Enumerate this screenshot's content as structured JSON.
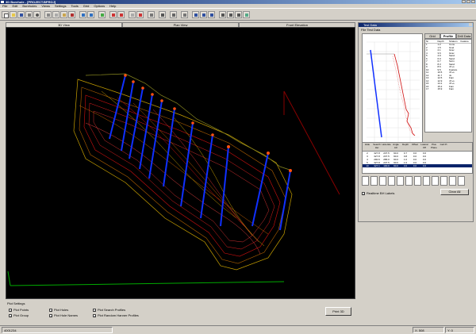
{
  "window": {
    "title": "3D Borehole - [PROJECT.BPROJ]"
  },
  "menu": [
    "File",
    "Edit",
    "Boreholes",
    "Views",
    "Settings",
    "Tools",
    "Grid",
    "Options",
    "Help"
  ],
  "tabs": [
    {
      "label": "3D View",
      "active": true
    },
    {
      "label": "Plan View",
      "active": false
    },
    {
      "label": "Front Elevation",
      "active": false
    }
  ],
  "plot_settings": {
    "title": "Plot Settings",
    "options": [
      {
        "label": "Plot Points",
        "checked": true
      },
      {
        "label": "Plot Group",
        "checked": true
      },
      {
        "label": "Plot Holes",
        "checked": true
      },
      {
        "label": "Plot Hole Names",
        "checked": true
      },
      {
        "label": "Plot Search Profiles",
        "checked": true
      },
      {
        "label": "Plot Random Hanner Profiles",
        "checked": true
      }
    ],
    "button": "Print 3D"
  },
  "status": {
    "left": "4001234",
    "x": "X: 508",
    "y": "Y: 0"
  },
  "panel": {
    "title": "Test Data",
    "file_label": "File   Test Data",
    "tabs": [
      "Grid",
      "Profile",
      "Drill Data"
    ],
    "table_headers": [
      "Nr",
      "Depth",
      "Stratum",
      "Feature"
    ],
    "table_rows": [
      [
        "1",
        "1.2",
        "Cons",
        ""
      ],
      [
        "2",
        "1.5",
        "Gvel",
        ""
      ],
      [
        "3",
        "2.1",
        "Grav",
        ""
      ],
      [
        "4",
        "3.6",
        "Grav",
        ""
      ],
      [
        "5",
        "4.9",
        "Sand",
        ""
      ],
      [
        "6",
        "6.0",
        "Sand",
        ""
      ],
      [
        "7",
        "6.7",
        "Scrm",
        ""
      ],
      [
        "8",
        "8.3",
        "Sand",
        ""
      ],
      [
        "9",
        "8.6",
        "47+s",
        ""
      ],
      [
        "10",
        "9.5",
        "Feature",
        ""
      ],
      [
        "11",
        "10.5",
        "47+s",
        ""
      ],
      [
        "12",
        "11.7",
        "4x",
        ""
      ],
      [
        "13",
        "12.5",
        "Fam",
        ""
      ],
      [
        "14",
        "12.9",
        "47+s",
        ""
      ],
      [
        "15",
        "14.1",
        "47+s",
        ""
      ],
      [
        "16",
        "15.2",
        "Fam",
        ""
      ],
      [
        "17",
        "15.9",
        "Fam",
        ""
      ]
    ],
    "hole_headers": [
      "Hide",
      "Search Hei",
      "Hole Ele",
      "Angle Azi",
      "Depth",
      "Offset",
      "Lateral Off",
      "Plus Plane",
      "Cell Pt"
    ],
    "hole_rows": [
      {
        "cells": [
          "2",
          "327.8",
          "237.5",
          "90.0",
          "0.7",
          "0.0",
          "0.0",
          "",
          ""
        ],
        "selected": false
      },
      {
        "cells": [
          "3",
          "327.8",
          "237.5",
          "90.0",
          "0.8",
          "0.0",
          "0.0",
          "",
          ""
        ],
        "selected": false
      },
      {
        "cells": [
          "4",
          "290.6",
          "286.0",
          "90.0",
          "1.0",
          "0.0",
          "0.0",
          "",
          ""
        ],
        "selected": false
      },
      {
        "cells": [
          "5",
          "327.8",
          "237.5",
          "90.0",
          "1.0",
          "0.0",
          "0.0",
          "",
          ""
        ],
        "selected": false
      },
      {
        "cells": [
          "10",
          "327.1",
          "100.0",
          "90.0",
          "3.0",
          "0.0",
          "0.0",
          "",
          ""
        ],
        "selected": true
      }
    ],
    "realtime_label": "Realtime BH Labels",
    "realtime_checked": true,
    "clear_button": "Clear All"
  }
}
